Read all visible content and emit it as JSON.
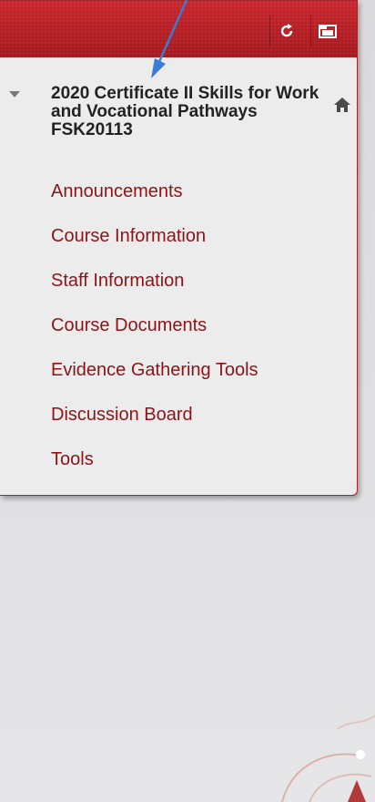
{
  "colors": {
    "accent": "#b41f25",
    "menu_text": "#8c1418",
    "panel_bg": "#ececec",
    "annotation_arrow": "#3a7bd5"
  },
  "toolbar": {
    "refresh_icon": "refresh-icon",
    "folder_icon": "folder-icon"
  },
  "course": {
    "title": "2020 Certificate II Skills for Work and Vocational Pathways FSK20113",
    "expand_icon": "caret-down-icon",
    "home_icon": "home-icon"
  },
  "menu": {
    "items": [
      {
        "label": "Announcements"
      },
      {
        "label": "Course Information"
      },
      {
        "label": "Staff Information"
      },
      {
        "label": "Course Documents"
      },
      {
        "label": "Evidence Gathering Tools"
      },
      {
        "label": "Discussion Board"
      },
      {
        "label": "Tools"
      }
    ]
  }
}
